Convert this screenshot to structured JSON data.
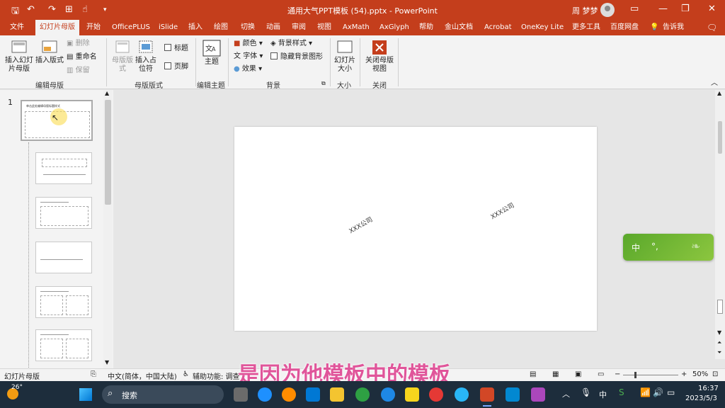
{
  "title_bar": {
    "document_title": "通用大气PPT模板 (54).pptx - PowerPoint",
    "user_name": "周 梦梦",
    "quick_access_icons": [
      "save-icon",
      "undo-icon",
      "redo-icon",
      "slideshow-icon",
      "customize-icon"
    ]
  },
  "tabs": [
    "文件",
    "幻灯片母版",
    "开始",
    "OfficePLUS",
    "iSlide",
    "插入",
    "绘图",
    "切换",
    "动画",
    "审阅",
    "视图",
    "AxMath",
    "AxGlyph",
    "帮助",
    "金山文档",
    "Acrobat",
    "OneKey Lite",
    "更多工具",
    "百度网盘",
    "告诉我"
  ],
  "ribbon": {
    "insert_slide_master": "插入幻灯片母版",
    "insert_layout": "插入版式",
    "delete": "删除",
    "rename": "重命名",
    "preserve": "保留",
    "group_edit_master": "编辑母版",
    "master_layout": "母版版式",
    "insert_placeholder": "插入占位符",
    "title_checkbox": "标题",
    "footer_checkbox": "页脚",
    "group_master_layout": "母版版式",
    "themes": "主题",
    "group_edit_theme": "编辑主题",
    "colors": "颜色",
    "fonts": "字体",
    "effects": "效果",
    "background_styles": "背景样式",
    "hide_background_graphics": "隐藏背景图形",
    "group_background": "背景",
    "slide_size": "幻灯片大小",
    "group_size": "大小",
    "close_master_view": "关闭母版视图",
    "group_close": "关闭"
  },
  "thumbnails": {
    "slide_number": "1",
    "master_title": "单击此处编辑母版标题样式"
  },
  "slide": {
    "stamp_left": "XXX公司",
    "stamp_right": "XXX公司"
  },
  "ime": {
    "mode": "中",
    "punct": "°,"
  },
  "status_bar": {
    "view_name": "幻灯片母版",
    "language": "中文(简体，中国大陆)",
    "accessibility": "辅助功能: 调查",
    "zoom": "50%"
  },
  "subtitle": "是因为他模板中的模板",
  "taskbar": {
    "weather_temp": "26°",
    "search_placeholder": "搜索",
    "ime_indicator": "中",
    "time": "16:37",
    "date": "2023/5/3"
  },
  "colors": {
    "accent": "#c43e1c",
    "ribbon_bg": "#f3f3f3",
    "subtitle": "#e0559a",
    "taskbar": "#1d2d3c"
  }
}
